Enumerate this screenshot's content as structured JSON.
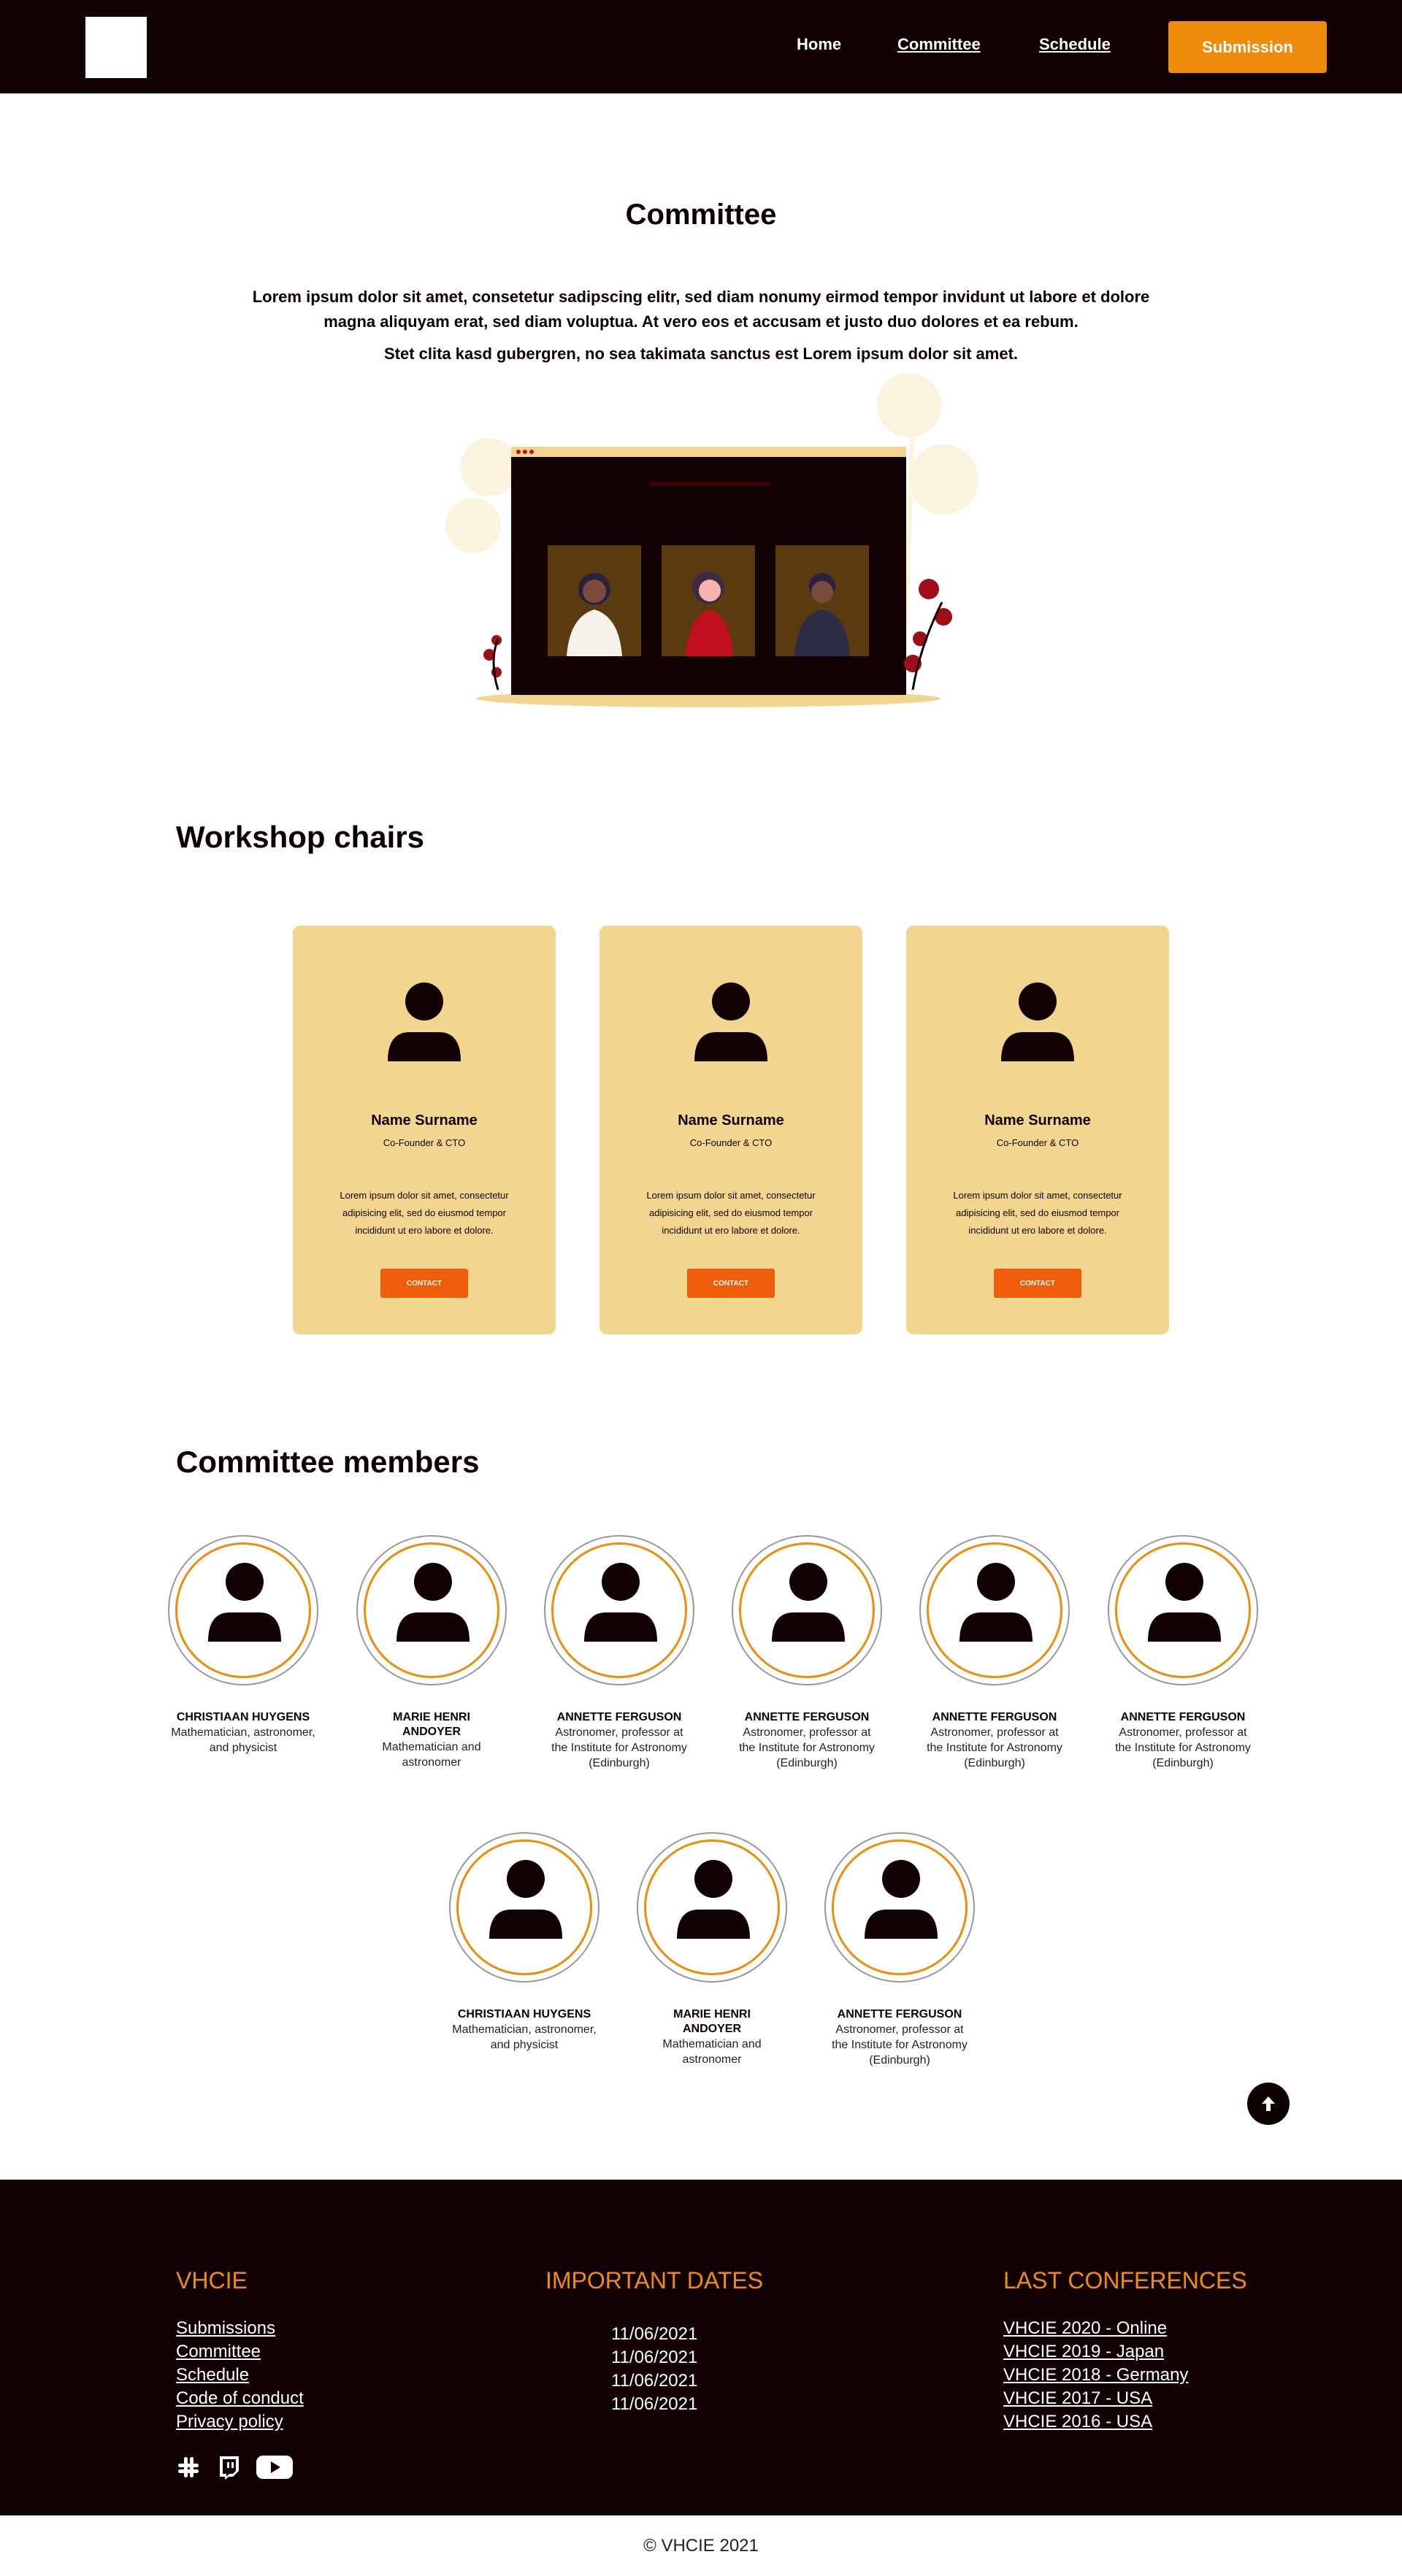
{
  "nav": {
    "home": "Home",
    "committee": "Committee",
    "schedule": "Schedule",
    "submission": "Submission"
  },
  "intro": {
    "title": "Committee",
    "paragraph1": "Lorem ipsum dolor sit amet, consetetur sadipscing elitr, sed diam nonumy eirmod tempor invidunt ut labore et dolore magna aliquyam erat, sed diam voluptua. At vero eos et accusam et justo duo dolores et ea rebum.",
    "paragraph2": "Stet clita kasd gubergren, no sea takimata sanctus est Lorem ipsum dolor sit amet."
  },
  "chairs": {
    "title": "Workshop chairs",
    "cards": [
      {
        "name": "Name Surname",
        "role": "Co-Founder & CTO",
        "description": "Lorem ipsum dolor sit amet, consectetur adipisicing elit, sed do eiusmod tempor incididunt ut ero labore et dolore.",
        "button": "CONTACT"
      },
      {
        "name": "Name Surname",
        "role": "Co-Founder & CTO",
        "description": "Lorem ipsum dolor sit amet, consectetur adipisicing elit, sed do eiusmod tempor incididunt ut ero labore et dolore.",
        "button": "CONTACT"
      },
      {
        "name": "Name Surname",
        "role": "Co-Founder & CTO",
        "description": "Lorem ipsum dolor sit amet, consectetur adipisicing elit, sed do eiusmod tempor incididunt ut ero labore et dolore.",
        "button": "CONTACT"
      }
    ]
  },
  "members": {
    "title": "Committee members",
    "list": [
      {
        "name": "CHRISTIAAN HUYGENS",
        "description": "Mathematician, astronomer, and physicist"
      },
      {
        "name": "MARIE HENRI ANDOYER",
        "description": "Mathematician and astronomer"
      },
      {
        "name": "ANNETTE FERGUSON",
        "description": "Astronomer, professor at the Institute for Astronomy (Edinburgh)"
      },
      {
        "name": "ANNETTE FERGUSON",
        "description": "Astronomer, professor at the Institute for Astronomy (Edinburgh)"
      },
      {
        "name": "ANNETTE FERGUSON",
        "description": "Astronomer, professor at the Institute for Astronomy (Edinburgh)"
      },
      {
        "name": "ANNETTE FERGUSON",
        "description": "Astronomer, professor at the Institute for Astronomy (Edinburgh)"
      },
      {
        "name": "CHRISTIAAN HUYGENS",
        "description": "Mathematician, astronomer, and physicist"
      },
      {
        "name": "MARIE HENRI ANDOYER",
        "description": "Mathematician and astronomer"
      },
      {
        "name": "ANNETTE FERGUSON",
        "description": "Astronomer, professor at the Institute for Astronomy (Edinburgh)"
      }
    ]
  },
  "footer": {
    "col1_title": "VHCIE",
    "col1_links": [
      "Submissions",
      "Committee",
      "Schedule",
      "Code of conduct",
      "Privacy policy"
    ],
    "col2_title": "IMPORTANT DATES",
    "col2_dates": [
      "11/06/2021",
      "11/06/2021",
      "11/06/2021",
      "11/06/2021"
    ],
    "col3_title": "LAST CONFERENCES",
    "col3_links": [
      "VHCIE 2020 - Online",
      "VHCIE 2019 - Japan",
      "VHCIE 2018 - Germany",
      "VHCIE 2017 - USA",
      "VHCIE 2016 - USA"
    ],
    "socials": [
      "slack-icon",
      "twitch-icon",
      "youtube-icon"
    ],
    "copyright": "© VHCIE 2021"
  },
  "colors": {
    "header_bg": "#120103",
    "accent": "#f08c0b",
    "card_bg": "#f2d68f",
    "contact_button": "#ef5d0a"
  }
}
